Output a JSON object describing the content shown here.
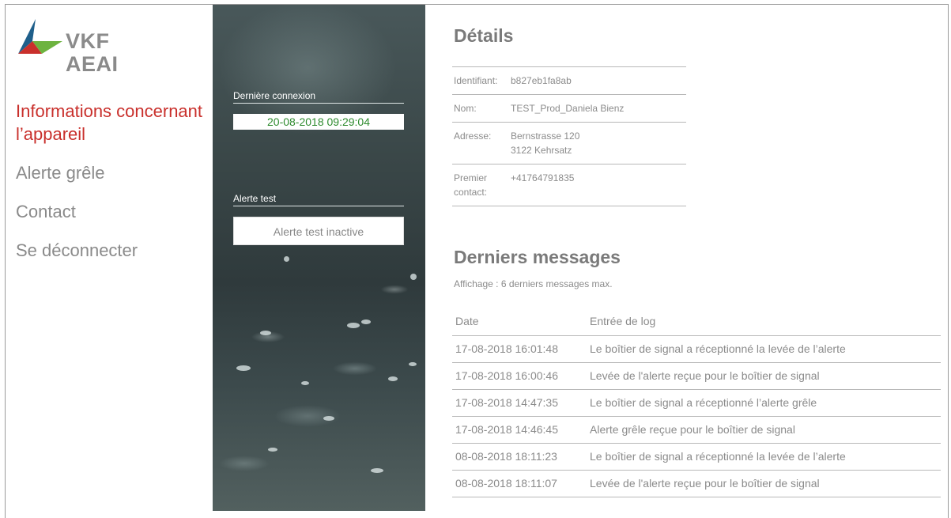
{
  "logo": {
    "line1": "VKF",
    "line2": "AEAI"
  },
  "nav": {
    "items": [
      {
        "label": "Informations concernant l’appareil",
        "active": true
      },
      {
        "label": "Alerte grêle",
        "active": false
      },
      {
        "label": "Contact",
        "active": false
      },
      {
        "label": "Se déconnecter",
        "active": false
      }
    ]
  },
  "panel": {
    "last_connection_label": "Dernière connexion",
    "last_connection_value": "20-08-2018 09:29:04",
    "test_alert_label": "Alerte test",
    "test_alert_button": "Alerte test inactive"
  },
  "details": {
    "title": "Détails",
    "rows": [
      {
        "key": "Identifiant:",
        "value": "b827eb1fa8ab"
      },
      {
        "key": "Nom:",
        "value": "TEST_Prod_Daniela Bienz"
      },
      {
        "key": "Adresse:",
        "value": "Bernstrasse 120",
        "value2": "3122 Kehrsatz"
      },
      {
        "key": "Premier contact:",
        "value": "+41764791835"
      }
    ]
  },
  "messages": {
    "title": "Derniers messages",
    "note": "Affichage : 6 derniers messages max.",
    "columns": [
      "Date",
      "Entrée de log"
    ],
    "rows": [
      {
        "date": "17-08-2018 16:01:48",
        "entry": "Le boîtier de signal a réceptionné la levée de l’alerte"
      },
      {
        "date": "17-08-2018 16:00:46",
        "entry": "Levée de l'alerte reçue pour le boîtier de signal"
      },
      {
        "date": "17-08-2018 14:47:35",
        "entry": "Le boîtier de signal a réceptionné l’alerte grêle"
      },
      {
        "date": "17-08-2018 14:46:45",
        "entry": "Alerte grêle reçue pour le boîtier de signal"
      },
      {
        "date": "08-08-2018 18:11:23",
        "entry": "Le boîtier de signal a réceptionné la levée de l’alerte"
      },
      {
        "date": "08-08-2018 18:11:07",
        "entry": "Levée de l'alerte reçue pour le boîtier de signal"
      }
    ]
  },
  "colors": {
    "accent_red": "#c9302c",
    "logo_blue": "#1f5f8b",
    "logo_green": "#6db33f",
    "text_gray": "#8a8a8a",
    "date_green": "#2e8b2e"
  }
}
